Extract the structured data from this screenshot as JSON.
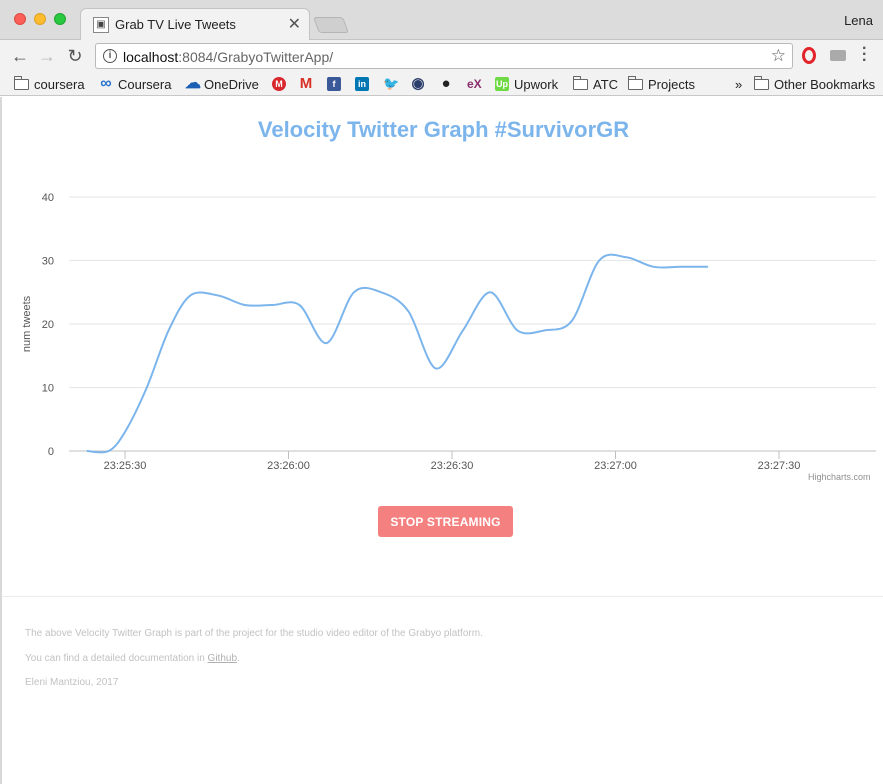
{
  "browser": {
    "tab_title": "Grab TV Live Tweets",
    "profile_name": "Lena",
    "url_host": "localhost",
    "url_rest": ":8084/GrabyoTwitterApp/",
    "bookmarks": [
      {
        "label": "coursera",
        "icon": "folder-icon"
      },
      {
        "label": "Coursera",
        "icon": "coursera-icon"
      },
      {
        "label": "OneDrive",
        "icon": "onedrive-icon"
      },
      {
        "label": "",
        "icon": "mega-icon"
      },
      {
        "label": "",
        "icon": "gmail-icon"
      },
      {
        "label": "",
        "icon": "facebook-icon"
      },
      {
        "label": "",
        "icon": "linkedin-icon"
      },
      {
        "label": "",
        "icon": "twitter-icon"
      },
      {
        "label": "",
        "icon": "db-icon"
      },
      {
        "label": "",
        "icon": "github-icon"
      },
      {
        "label": "",
        "icon": "edx-icon"
      },
      {
        "label": "Upwork",
        "icon": "upwork-icon"
      },
      {
        "label": "ATC",
        "icon": "folder-icon"
      },
      {
        "label": "Projects",
        "icon": "folder-icon"
      }
    ],
    "overflow_chevron": "»",
    "other_bookmarks": "Other Bookmarks"
  },
  "page": {
    "stop_button": "STOP STREAMING",
    "credits": "Highcharts.com",
    "footer": {
      "line1": "The above Velocity Twitter Graph is part of the project for the studio video editor of the Grabyo platform.",
      "line2_pre": "You can find a detailed documentation in ",
      "line2_link": "Github",
      "line2_post": ".",
      "line3": "Eleni Mantziou, 2017"
    }
  },
  "chart_data": {
    "type": "line",
    "title": "Velocity Twitter Graph #SurvivorGR",
    "xlabel": "",
    "ylabel": "num tweets",
    "ylim": [
      0,
      40
    ],
    "yticks": [
      0,
      10,
      20,
      30,
      40
    ],
    "xticks": [
      "23:25:30",
      "23:26:00",
      "23:26:30",
      "23:27:00",
      "23:27:30"
    ],
    "x_seconds": [
      -7,
      -3,
      0,
      4,
      8,
      12,
      17,
      22,
      27,
      32,
      37,
      42,
      47,
      52,
      57,
      62,
      67,
      72,
      77,
      82,
      87,
      92,
      97,
      102,
      107
    ],
    "values": [
      0,
      0,
      3,
      10,
      19,
      24.5,
      24.5,
      23,
      23,
      23,
      17,
      25,
      25,
      22,
      13,
      19,
      25,
      19,
      19,
      20.5,
      30,
      30.5,
      29,
      29,
      29
    ],
    "grid": true,
    "legend": "none",
    "color": "#7cb5ec"
  }
}
